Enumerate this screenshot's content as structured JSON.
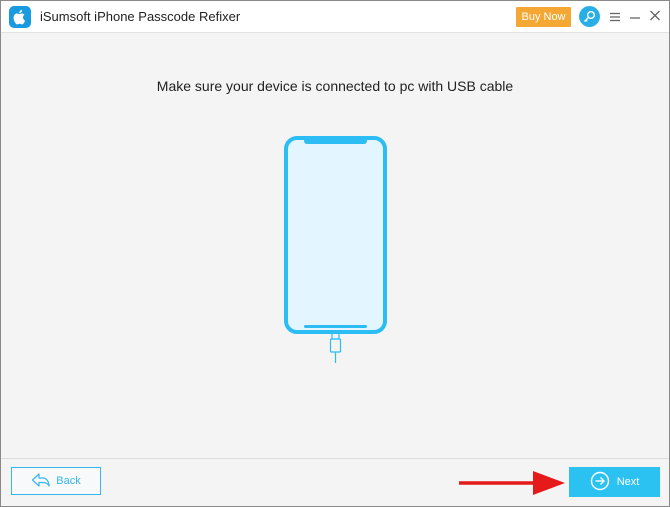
{
  "window": {
    "title": "iSumsoft iPhone Passcode Refixer"
  },
  "header": {
    "buy_now_label": "Buy Now",
    "icons": {
      "logo": "apple-icon",
      "key": "key-search-icon",
      "menu": "menu-icon",
      "minimize": "minimize-icon",
      "close": "close-icon"
    }
  },
  "main": {
    "instruction": "Make sure your device is connected to pc with USB cable",
    "illustration_icon": "phone-usb-icon"
  },
  "footer": {
    "back_label": "Back",
    "next_label": "Next",
    "back_icon": "back-arrow-icon",
    "next_icon": "circle-arrow-right-icon",
    "annotation_icon": "red-arrow-icon"
  },
  "colors": {
    "accent": "#2bc1f1",
    "buy_now": "#f4a733",
    "annotation": "#e51b1b",
    "background": "#f4f4f4"
  }
}
